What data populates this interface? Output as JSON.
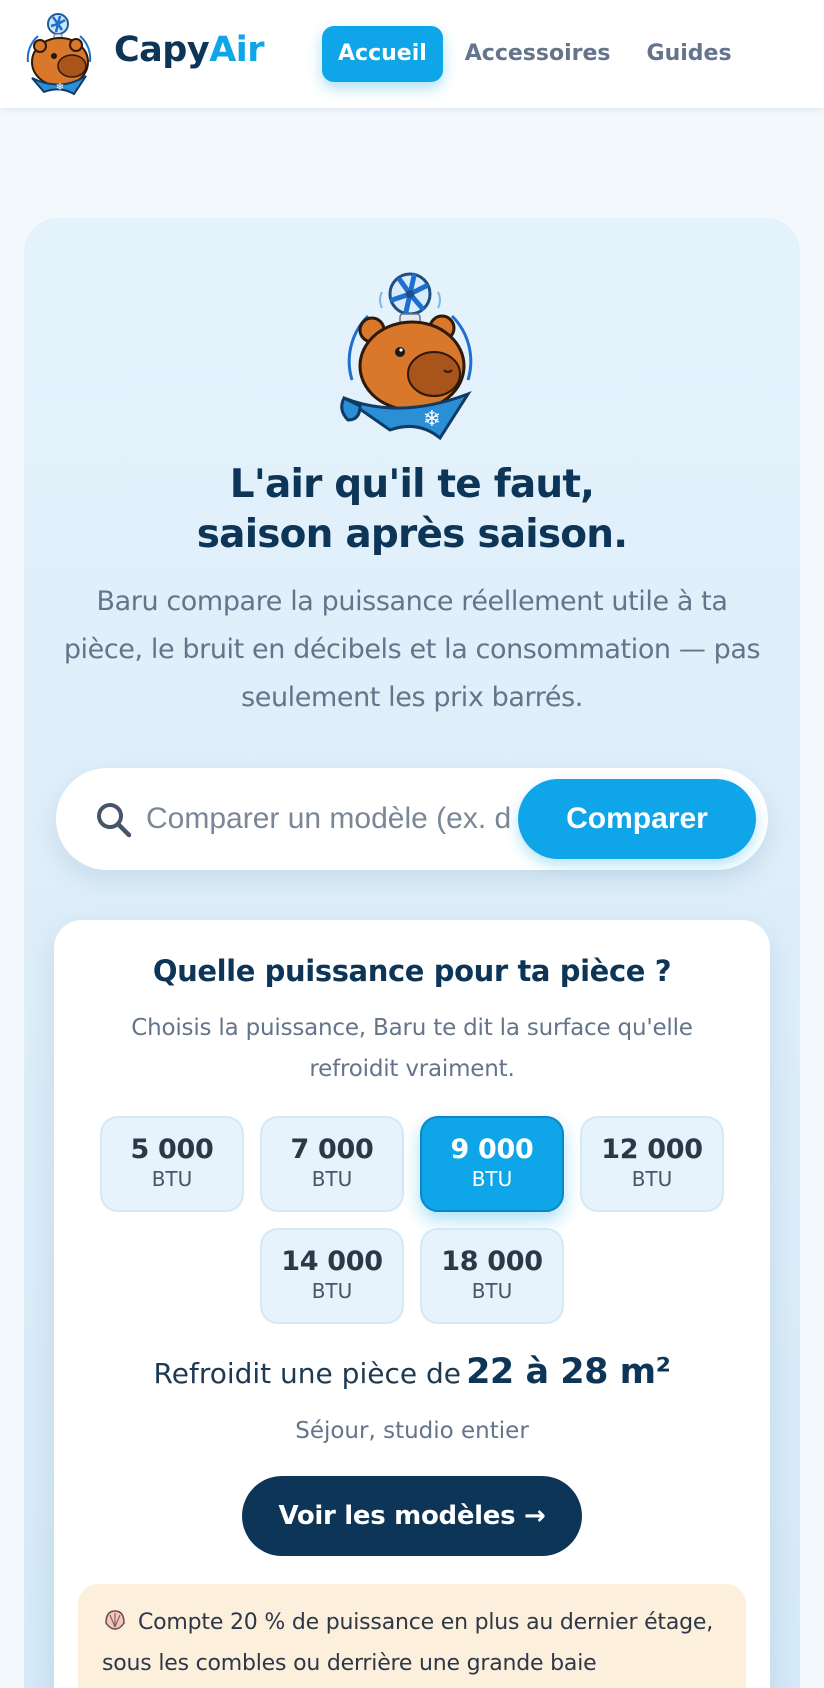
{
  "brand": {
    "name_part1": "Capy",
    "name_part2": "Air",
    "logo_icon": "capybara-fan-logo-icon"
  },
  "nav": {
    "items": [
      {
        "label": "Accueil",
        "active": true
      },
      {
        "label": "Accessoires",
        "active": false
      },
      {
        "label": "Guides",
        "active": false
      }
    ]
  },
  "hero": {
    "mascot_icon": "capybara-mascot-icon",
    "headline_line1": "L'air qu'il te faut,",
    "headline_line2": "saison après saison.",
    "subtext": "Baru compare la puissance réellement utile à ta pièce, le bruit en décibels et la consommation — pas seulement les prix barrés."
  },
  "search": {
    "icon": "search-icon",
    "placeholder": "Comparer un modèle (ex. d",
    "button_label": "Comparer"
  },
  "calculator": {
    "title": "Quelle puissance pour ta pièce ?",
    "description": "Choisis la puissance, Baru te dit la surface qu'elle refroidit vraiment.",
    "unit": "BTU",
    "options": [
      {
        "value": "5 000",
        "selected": false
      },
      {
        "value": "7 000",
        "selected": false
      },
      {
        "value": "9 000",
        "selected": true
      },
      {
        "value": "12 000",
        "selected": false
      },
      {
        "value": "14 000",
        "selected": false
      },
      {
        "value": "18 000",
        "selected": false
      }
    ],
    "result_label": "Refroidit une pièce de",
    "result_value": "22 à 28 m²",
    "result_note": "Séjour, studio entier",
    "cta_label": "Voir les modèles →",
    "tip_icon": "shell-icon",
    "tip_text": "Compte 20 % de puissance en plus au dernier étage, sous les combles ou derrière une grande baie"
  },
  "colors": {
    "accent": "#0ea5e9",
    "navy": "#0d3557",
    "muted": "#64748b",
    "tip_bg": "#fcf0dc"
  }
}
